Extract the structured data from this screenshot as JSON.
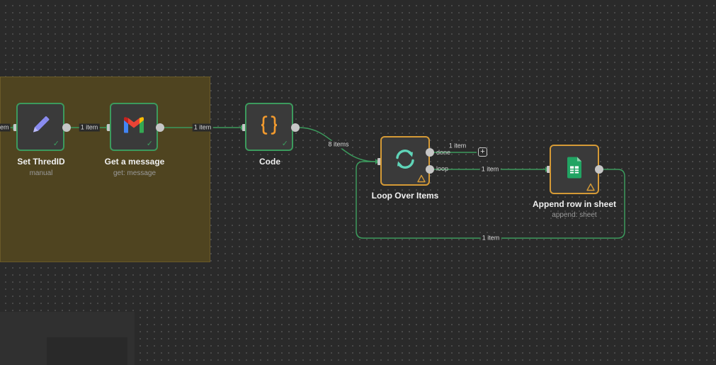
{
  "colors": {
    "success": "#3c9a5d",
    "warning": "#d59a36",
    "sticky": "#4f4420",
    "canvas": "#2a2a2a"
  },
  "nodes": {
    "set_thread": {
      "title": "Set ThredID",
      "subtitle": "manual",
      "icon": "pencil-icon",
      "status": "success"
    },
    "get_message": {
      "title": "Get a message",
      "subtitle": "get: message",
      "icon": "gmail-icon",
      "status": "success"
    },
    "code": {
      "title": "Code",
      "subtitle": "",
      "icon": "code-braces-icon",
      "status": "success"
    },
    "loop": {
      "title": "Loop Over Items",
      "subtitle": "",
      "icon": "loop-icon",
      "status": "warning",
      "outputs": [
        "done",
        "loop"
      ]
    },
    "append_row": {
      "title": "Append row in sheet",
      "subtitle": "append: sheet",
      "icon": "google-sheets-icon",
      "status": "warning"
    }
  },
  "edges": {
    "incoming_partial": "item",
    "set_to_get": "1 item",
    "get_to_code": "1 item",
    "code_to_loop": "8 items",
    "loop_done": "1 item",
    "loop_to_append": "1 item",
    "append_back_to_loop": "1 item"
  },
  "add_button": "+"
}
